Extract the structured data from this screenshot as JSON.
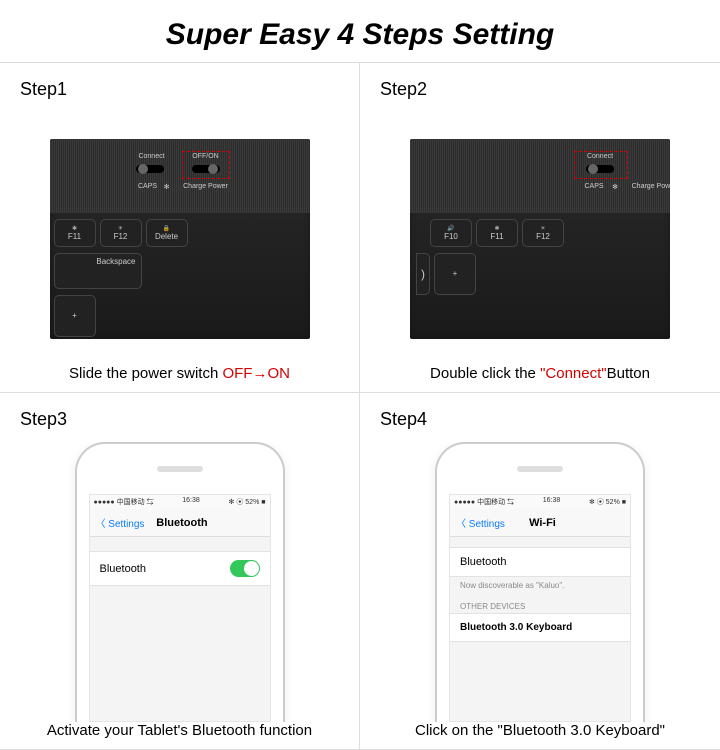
{
  "title": "Super Easy 4 Steps Setting",
  "steps": {
    "s1": {
      "label": "Step1",
      "caption_a": "Slide the power switch ",
      "caption_red": "OFF→ON"
    },
    "s2": {
      "label": "Step2",
      "caption_a": "Double click the ",
      "caption_red": "\"Connect\"",
      "caption_b": "Button"
    },
    "s3": {
      "label": "Step3",
      "caption": "Activate your Tablet's Bluetooth function"
    },
    "s4": {
      "label": "Step4",
      "caption": "Click on the \"Bluetooth 3.0 Keyboard\""
    }
  },
  "kb": {
    "connect": "Connect",
    "offon": "OFF/ON",
    "caps": "CAPS",
    "bt": "✻",
    "charge": "Charge Power",
    "keys1": [
      "F11",
      "F12",
      "Delete"
    ],
    "keys1_icons": [
      "✱",
      "☀",
      "🔒"
    ],
    "keys1b": "Backspace",
    "keys2": [
      "F10",
      "F11",
      "F12"
    ],
    "keys2_icons": [
      "🔊",
      "✱",
      "☀"
    ],
    "plus": "+"
  },
  "phone": {
    "status_l": "●●●●● 中国移动 ⇆",
    "status_c": "16:38",
    "status_r": "✻ ⦿ 52% ■",
    "back": "〈 Settings",
    "bt_title": "Bluetooth",
    "wifi_title": "Wi-Fi",
    "bt_row": "Bluetooth",
    "discover": "Now discoverable as \"Kaluo\".",
    "other": "OTHER DEVICES",
    "device": "Bluetooth 3.0 Keyboard"
  }
}
